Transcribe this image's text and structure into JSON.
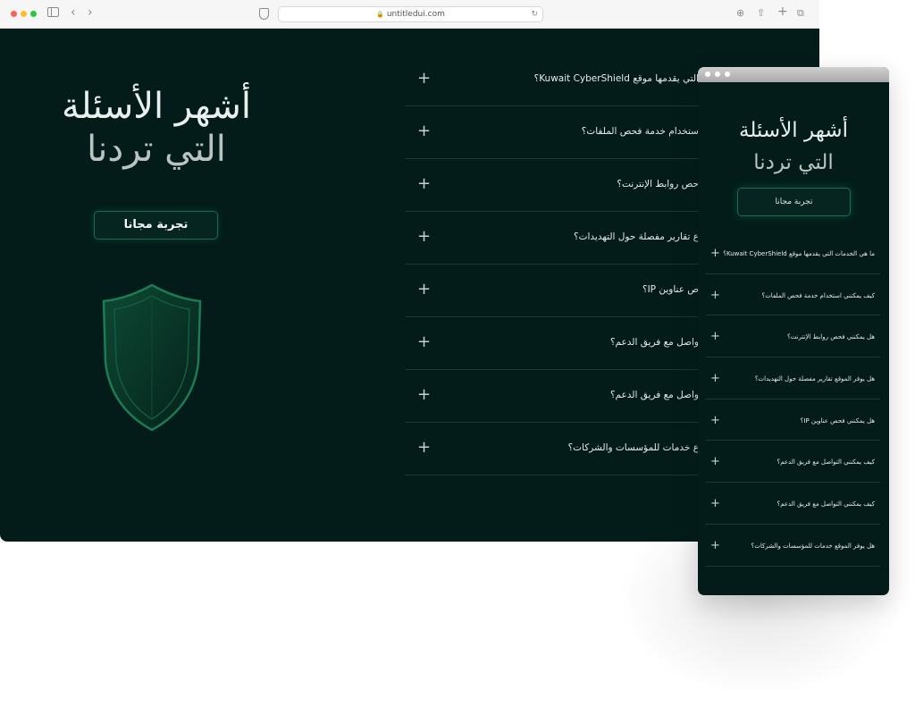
{
  "browser": {
    "url": "untitledui.com"
  },
  "hero": {
    "title_line1": "أشهر الأسئلة",
    "title_line2": "التي تردنا",
    "cta_label": "تجربة مجانا"
  },
  "faq_desktop": [
    {
      "question": "التي يقدمها موقع Kuwait CyberShield؟"
    },
    {
      "question": "ستخدام خدمة فحص الملفات؟"
    },
    {
      "question": "حص روابط الإنترنت؟"
    },
    {
      "question": "ع تقارير مفصلة حول التهديدات؟"
    },
    {
      "question": "ص عناوين IP؟"
    },
    {
      "question": "واصل مع فريق الدعم؟"
    },
    {
      "question": "واصل مع فريق الدعم؟"
    },
    {
      "question": "ع خدمات للمؤسسات والشركات؟"
    }
  ],
  "mobile": {
    "title_line1": "أشهر الأسئلة",
    "title_line2": "التي تردنا",
    "cta_label": "تجربة مجانا",
    "faq": [
      {
        "question": "ما هي الخدمات التي يقدمها موقع Kuwait CyberShield؟"
      },
      {
        "question": "كيف يمكنني استخدام خدمة فحص الملفات؟"
      },
      {
        "question": "هل يمكنني فحص روابط الإنترنت؟"
      },
      {
        "question": "هل يوفر الموقع تقارير مفصلة حول التهديدات؟"
      },
      {
        "question": "هل يمكنني فحص عناوين IP؟"
      },
      {
        "question": "كيف يمكنني التواصل مع فريق الدعم؟"
      },
      {
        "question": "كيف يمكنني التواصل مع فريق الدعم؟"
      },
      {
        "question": "هل يوفر الموقع خدمات للمؤسسات والشركات؟"
      }
    ]
  },
  "icons": {
    "expand": "+",
    "shield": "shield-icon"
  },
  "colors": {
    "background": "#031c1a",
    "accent": "#1e6b4d",
    "text": "#e6ecea"
  }
}
